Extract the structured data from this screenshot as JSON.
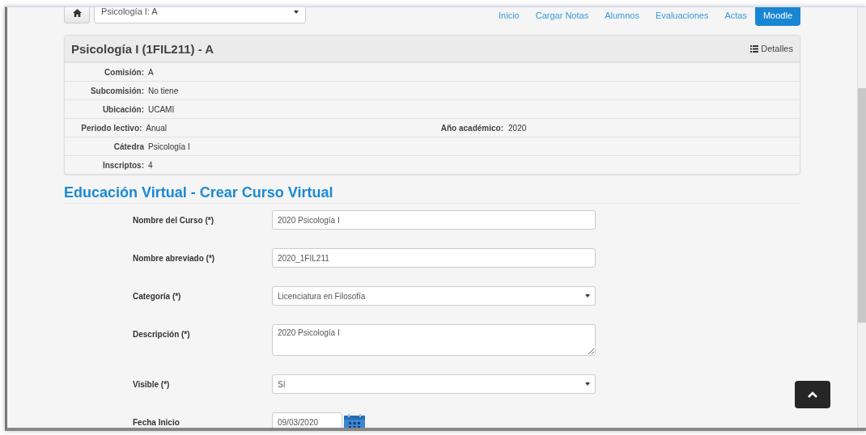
{
  "nav": {
    "course_selector": "Psicología I: A",
    "links": [
      {
        "label": "Inicio",
        "selected": false
      },
      {
        "label": "Cargar Notas",
        "selected": false
      },
      {
        "label": "Alumnos",
        "selected": false
      },
      {
        "label": "Evaluaciones",
        "selected": false
      },
      {
        "label": "Actas",
        "selected": false
      },
      {
        "label": "Moodle",
        "selected": true
      }
    ]
  },
  "panel": {
    "title": "Psicología I (1FIL211) - A",
    "details_button": "Detalles",
    "rows": [
      {
        "label": "Comisión:",
        "value": "A"
      },
      {
        "label": "Subcomisión:",
        "value": "No tiene"
      },
      {
        "label": "Ubicación:",
        "value": "UCAMI"
      },
      {
        "label": "Periodo lectivo:",
        "value": "Anual",
        "label_2": "Año académico:",
        "value_2": "2020"
      },
      {
        "label": "Cátedra",
        "value": "Psicología I"
      },
      {
        "label": "Inscriptos:",
        "value": "4"
      }
    ]
  },
  "form": {
    "title": "Educación Virtual - Crear Curso Virtual",
    "fields": [
      {
        "kind": "text",
        "label": "Nombre del Curso (*)",
        "value": "2020 Psicología I"
      },
      {
        "kind": "text",
        "label": "Nombre abreviado (*)",
        "value": "2020_1FIL211"
      },
      {
        "kind": "select",
        "label": "Categoría (*)",
        "value": "Licenciatura en Filosofía"
      },
      {
        "kind": "textarea",
        "label": "Descripción (*)",
        "value": "2020 Psicología I"
      },
      {
        "kind": "select",
        "label": "Visible (*)",
        "value": "Sí"
      },
      {
        "kind": "date",
        "label": "Fecha Inicio",
        "value": "09/03/2020"
      }
    ]
  }
}
